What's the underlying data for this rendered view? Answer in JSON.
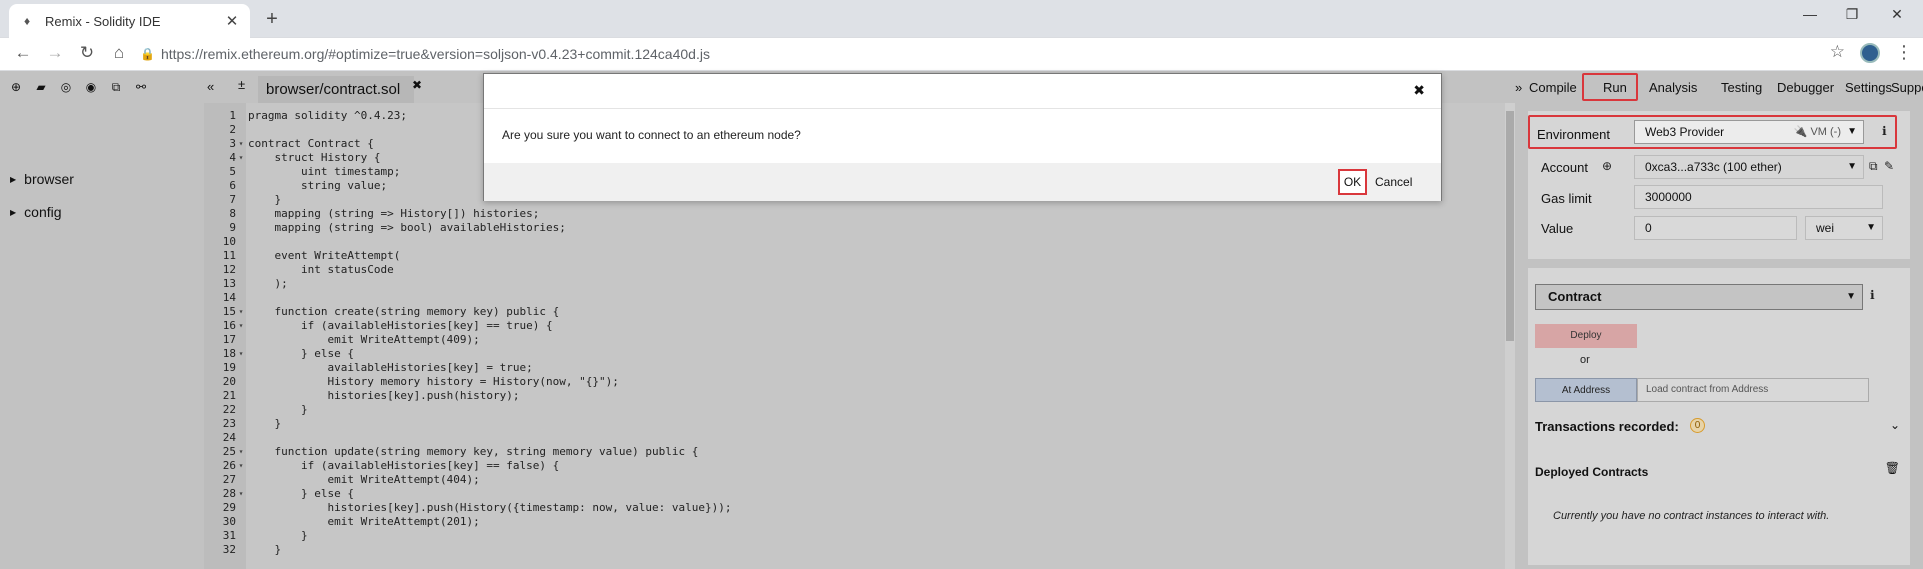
{
  "browser": {
    "tab_title": "Remix - Solidity IDE",
    "tab_close": "✕",
    "new_tab": "+",
    "url": "https://remix.ethereum.org/#optimize=true&version=soljson-v0.4.23+commit.124ca40d.js"
  },
  "file_panel": {
    "tree": [
      "browser",
      "config"
    ]
  },
  "editor": {
    "tab": "browser/contract.sol",
    "tab_close": "✖",
    "lines": [
      {
        "n": "1",
        "f": "",
        "t": "pragma solidity ^0.4.23;"
      },
      {
        "n": "2",
        "f": "",
        "t": ""
      },
      {
        "n": "3",
        "f": "▾",
        "t": "contract Contract {"
      },
      {
        "n": "4",
        "f": "▾",
        "t": "    struct History {"
      },
      {
        "n": "5",
        "f": "",
        "t": "        uint timestamp;"
      },
      {
        "n": "6",
        "f": "",
        "t": "        string value;"
      },
      {
        "n": "7",
        "f": "",
        "t": "    }"
      },
      {
        "n": "8",
        "f": "",
        "t": "    mapping (string => History[]) histories;"
      },
      {
        "n": "9",
        "f": "",
        "t": "    mapping (string => bool) availableHistories;"
      },
      {
        "n": "10",
        "f": "",
        "t": ""
      },
      {
        "n": "11",
        "f": "",
        "t": "    event WriteAttempt("
      },
      {
        "n": "12",
        "f": "",
        "t": "        int statusCode"
      },
      {
        "n": "13",
        "f": "",
        "t": "    );"
      },
      {
        "n": "14",
        "f": "",
        "t": ""
      },
      {
        "n": "15",
        "f": "▾",
        "t": "    function create(string memory key) public {"
      },
      {
        "n": "16",
        "f": "▾",
        "t": "        if (availableHistories[key] == true) {"
      },
      {
        "n": "17",
        "f": "",
        "t": "            emit WriteAttempt(409);"
      },
      {
        "n": "18",
        "f": "▾",
        "t": "        } else {"
      },
      {
        "n": "19",
        "f": "",
        "t": "            availableHistories[key] = true;"
      },
      {
        "n": "20",
        "f": "",
        "t": "            History memory history = History(now, \"{}\");"
      },
      {
        "n": "21",
        "f": "",
        "t": "            histories[key].push(history);"
      },
      {
        "n": "22",
        "f": "",
        "t": "        }"
      },
      {
        "n": "23",
        "f": "",
        "t": "    }"
      },
      {
        "n": "24",
        "f": "",
        "t": ""
      },
      {
        "n": "25",
        "f": "▾",
        "t": "    function update(string memory key, string memory value) public {"
      },
      {
        "n": "26",
        "f": "▾",
        "t": "        if (availableHistories[key] == false) {"
      },
      {
        "n": "27",
        "f": "",
        "t": "            emit WriteAttempt(404);"
      },
      {
        "n": "28",
        "f": "▾",
        "t": "        } else {"
      },
      {
        "n": "29",
        "f": "",
        "t": "            histories[key].push(History({timestamp: now, value: value}));"
      },
      {
        "n": "30",
        "f": "",
        "t": "            emit WriteAttempt(201);"
      },
      {
        "n": "31",
        "f": "",
        "t": "        }"
      },
      {
        "n": "32",
        "f": "",
        "t": "    }"
      }
    ]
  },
  "right_tabs": {
    "collapse": "»",
    "compile": "Compile",
    "run": "Run",
    "analysis": "Analysis",
    "testing": "Testing",
    "debugger": "Debugger",
    "settings": "Settings",
    "support": "Suppo"
  },
  "run_panel": {
    "environment_label": "Environment",
    "environment_value": "Web3 Provider",
    "environment_hint": "VM (-)",
    "account_label": "Account",
    "account_value": "0xca3...a733c (100 ether)",
    "gas_label": "Gas limit",
    "gas_value": "3000000",
    "value_label": "Value",
    "value_value": "0",
    "unit_value": "wei",
    "contract_select": "Contract",
    "deploy": "Deploy",
    "or": "or",
    "at_address": "At Address",
    "address_placeholder": "Load contract from Address",
    "tx_recorded": "Transactions recorded:",
    "tx_count": "0",
    "deployed_title": "Deployed Contracts",
    "deployed_empty": "Currently you have no contract instances to interact with."
  },
  "modal": {
    "close": "✖",
    "message": "Are you sure you want to connect to an ethereum node?",
    "ok": "OK",
    "cancel": "Cancel"
  }
}
